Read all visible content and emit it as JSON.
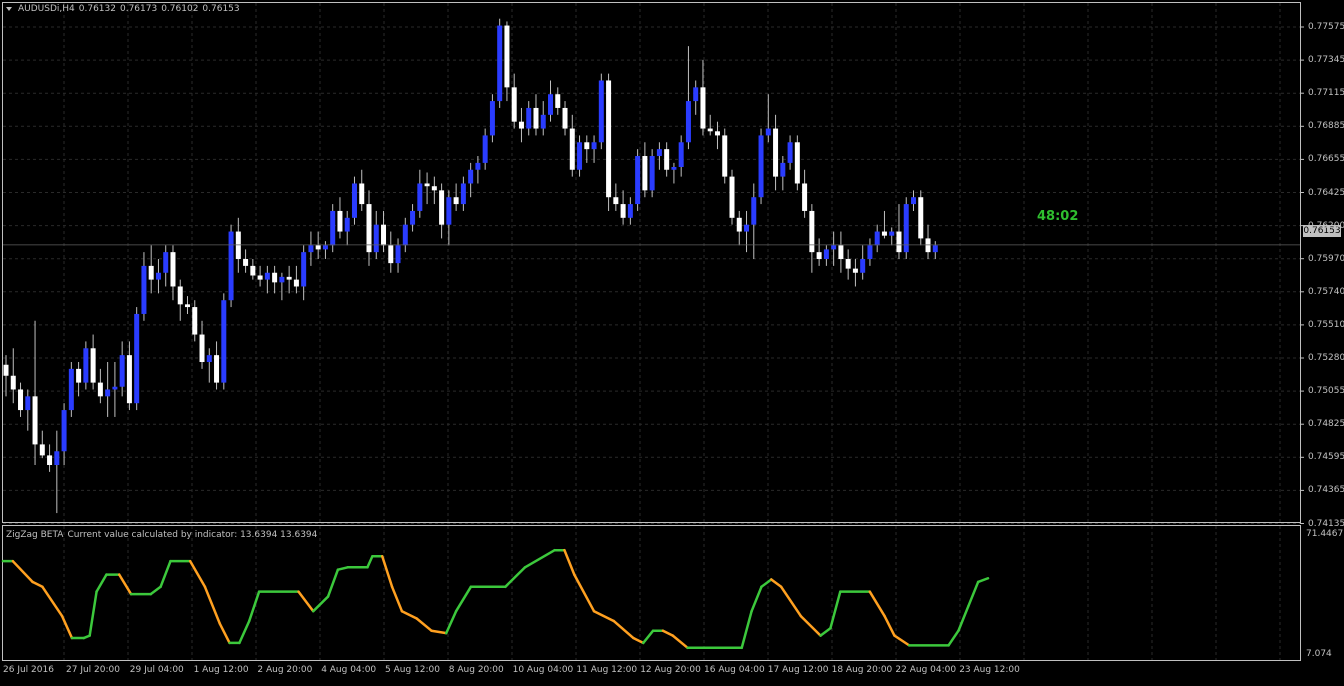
{
  "header": {
    "symbol": "AUDUSDi,H4",
    "ohlc": [
      "0.76132",
      "0.76173",
      "0.76102",
      "0.76153"
    ]
  },
  "timer": "48:02",
  "current_price": "0.76153",
  "price_axis": [
    "0.77575",
    "0.77345",
    "0.77115",
    "0.76885",
    "0.76655",
    "0.76425",
    "0.76200",
    "0.75970",
    "0.75740",
    "0.75510",
    "0.75280",
    "0.75055",
    "0.74825",
    "0.74595",
    "0.74365",
    "0.74135"
  ],
  "indicator": {
    "title": "ZigZag BETA",
    "subtitle": "Current value calculated by indicator: 13.6394 13.6394",
    "axis_max": "71.4467",
    "axis_min": "7.074"
  },
  "time_axis": [
    "26 Jul 2016",
    "27 Jul 20:00",
    "29 Jul 04:00",
    "1 Aug 12:00",
    "2 Aug 20:00",
    "4 Aug 04:00",
    "5 Aug 12:00",
    "8 Aug 20:00",
    "10 Aug 04:00",
    "11 Aug 12:00",
    "12 Aug 20:00",
    "16 Aug 04:00",
    "17 Aug 12:00",
    "18 Aug 20:00",
    "22 Aug 04:00",
    "23 Aug 12:00"
  ],
  "colors": {
    "bull": "#2a3cff",
    "bear": "#ffffff",
    "wick": "#c0c0c0",
    "grid": "#2a2a2a",
    "osc_up": "#3cc83c",
    "osc_down": "#ffa020",
    "timer": "#2fbf2f"
  },
  "chart_data": {
    "type": "candlestick",
    "ylim": [
      0.74135,
      0.77805
    ],
    "candles": [
      [
        0.7528,
        0.7535,
        0.7505,
        0.752
      ],
      [
        0.752,
        0.754,
        0.75,
        0.751
      ],
      [
        0.751,
        0.7515,
        0.749,
        0.7495
      ],
      [
        0.7495,
        0.751,
        0.748,
        0.7505
      ],
      [
        0.7505,
        0.756,
        0.7455,
        0.747
      ],
      [
        0.747,
        0.748,
        0.746,
        0.7462
      ],
      [
        0.7462,
        0.747,
        0.745,
        0.7455
      ],
      [
        0.7455,
        0.748,
        0.742,
        0.7465
      ],
      [
        0.7465,
        0.75,
        0.7455,
        0.7495
      ],
      [
        0.7495,
        0.753,
        0.749,
        0.7525
      ],
      [
        0.7525,
        0.753,
        0.7505,
        0.7515
      ],
      [
        0.7515,
        0.7545,
        0.751,
        0.754
      ],
      [
        0.754,
        0.755,
        0.751,
        0.7515
      ],
      [
        0.7515,
        0.7525,
        0.75,
        0.7505
      ],
      [
        0.7505,
        0.753,
        0.749,
        0.751
      ],
      [
        0.751,
        0.753,
        0.749,
        0.7512
      ],
      [
        0.7512,
        0.7545,
        0.7505,
        0.7535
      ],
      [
        0.7535,
        0.7545,
        0.7495,
        0.75
      ],
      [
        0.75,
        0.757,
        0.7495,
        0.7565
      ],
      [
        0.7565,
        0.761,
        0.756,
        0.76
      ],
      [
        0.76,
        0.7615,
        0.758,
        0.759
      ],
      [
        0.759,
        0.7605,
        0.758,
        0.7595
      ],
      [
        0.7595,
        0.7615,
        0.7585,
        0.761
      ],
      [
        0.761,
        0.7615,
        0.7575,
        0.7585
      ],
      [
        0.7585,
        0.759,
        0.756,
        0.7572
      ],
      [
        0.7572,
        0.7578,
        0.7565,
        0.757
      ],
      [
        0.757,
        0.7575,
        0.7545,
        0.755
      ],
      [
        0.755,
        0.756,
        0.7525,
        0.753
      ],
      [
        0.753,
        0.754,
        0.7515,
        0.7535
      ],
      [
        0.7535,
        0.7545,
        0.751,
        0.7515
      ],
      [
        0.7515,
        0.758,
        0.751,
        0.7575
      ],
      [
        0.7575,
        0.763,
        0.757,
        0.7625
      ],
      [
        0.7625,
        0.7635,
        0.7595,
        0.7605
      ],
      [
        0.7605,
        0.7612,
        0.7595,
        0.76
      ],
      [
        0.76,
        0.7605,
        0.759,
        0.7593
      ],
      [
        0.7593,
        0.76,
        0.7585,
        0.759
      ],
      [
        0.759,
        0.76,
        0.758,
        0.7595
      ],
      [
        0.7595,
        0.76,
        0.758,
        0.7588
      ],
      [
        0.7588,
        0.7595,
        0.7575,
        0.7592
      ],
      [
        0.7592,
        0.76,
        0.758,
        0.759
      ],
      [
        0.759,
        0.76,
        0.758,
        0.7585
      ],
      [
        0.7585,
        0.7615,
        0.7575,
        0.761
      ],
      [
        0.761,
        0.7625,
        0.76,
        0.7615
      ],
      [
        0.7615,
        0.7625,
        0.7605,
        0.7612
      ],
      [
        0.7612,
        0.7618,
        0.7605,
        0.7615
      ],
      [
        0.7615,
        0.7645,
        0.761,
        0.764
      ],
      [
        0.764,
        0.765,
        0.762,
        0.7625
      ],
      [
        0.7625,
        0.764,
        0.7615,
        0.7635
      ],
      [
        0.7635,
        0.7665,
        0.763,
        0.766
      ],
      [
        0.766,
        0.767,
        0.764,
        0.7645
      ],
      [
        0.7645,
        0.7655,
        0.76,
        0.761
      ],
      [
        0.761,
        0.764,
        0.7605,
        0.763
      ],
      [
        0.763,
        0.764,
        0.761,
        0.7615
      ],
      [
        0.7615,
        0.7625,
        0.7595,
        0.7602
      ],
      [
        0.7602,
        0.762,
        0.7595,
        0.7615
      ],
      [
        0.7615,
        0.7635,
        0.761,
        0.763
      ],
      [
        0.763,
        0.7645,
        0.7625,
        0.764
      ],
      [
        0.764,
        0.767,
        0.7635,
        0.766
      ],
      [
        0.766,
        0.7668,
        0.7645,
        0.7658
      ],
      [
        0.7658,
        0.7665,
        0.7645,
        0.7655
      ],
      [
        0.7655,
        0.766,
        0.762,
        0.763
      ],
      [
        0.763,
        0.7655,
        0.7615,
        0.765
      ],
      [
        0.765,
        0.766,
        0.764,
        0.7645
      ],
      [
        0.7645,
        0.7665,
        0.764,
        0.766
      ],
      [
        0.766,
        0.7675,
        0.765,
        0.767
      ],
      [
        0.767,
        0.768,
        0.766,
        0.7675
      ],
      [
        0.7675,
        0.77,
        0.767,
        0.7695
      ],
      [
        0.7695,
        0.7725,
        0.769,
        0.772
      ],
      [
        0.772,
        0.778,
        0.7715,
        0.7775
      ],
      [
        0.7775,
        0.7778,
        0.772,
        0.773
      ],
      [
        0.773,
        0.774,
        0.77,
        0.7705
      ],
      [
        0.7705,
        0.7715,
        0.769,
        0.77
      ],
      [
        0.77,
        0.772,
        0.7695,
        0.7715
      ],
      [
        0.7715,
        0.7725,
        0.7695,
        0.77
      ],
      [
        0.77,
        0.772,
        0.7695,
        0.771
      ],
      [
        0.771,
        0.7735,
        0.7705,
        0.7725
      ],
      [
        0.7725,
        0.773,
        0.771,
        0.7715
      ],
      [
        0.7715,
        0.772,
        0.7695,
        0.77
      ],
      [
        0.77,
        0.771,
        0.7665,
        0.767
      ],
      [
        0.767,
        0.7695,
        0.7665,
        0.769
      ],
      [
        0.769,
        0.7695,
        0.7675,
        0.7685
      ],
      [
        0.7685,
        0.7695,
        0.7675,
        0.769
      ],
      [
        0.769,
        0.774,
        0.7685,
        0.7735
      ],
      [
        0.7735,
        0.774,
        0.764,
        0.765
      ],
      [
        0.765,
        0.766,
        0.764,
        0.7645
      ],
      [
        0.7645,
        0.7655,
        0.763,
        0.7635
      ],
      [
        0.7635,
        0.765,
        0.763,
        0.7645
      ],
      [
        0.7645,
        0.7685,
        0.764,
        0.768
      ],
      [
        0.768,
        0.769,
        0.765,
        0.7655
      ],
      [
        0.7655,
        0.7685,
        0.765,
        0.768
      ],
      [
        0.768,
        0.769,
        0.767,
        0.7685
      ],
      [
        0.7685,
        0.769,
        0.7665,
        0.767
      ],
      [
        0.767,
        0.7675,
        0.766,
        0.7672
      ],
      [
        0.7672,
        0.7695,
        0.7665,
        0.769
      ],
      [
        0.769,
        0.776,
        0.7685,
        0.772
      ],
      [
        0.772,
        0.7735,
        0.771,
        0.773
      ],
      [
        0.773,
        0.775,
        0.7695,
        0.77
      ],
      [
        0.77,
        0.771,
        0.7695,
        0.7698
      ],
      [
        0.7698,
        0.7705,
        0.7685,
        0.7695
      ],
      [
        0.7695,
        0.77,
        0.766,
        0.7665
      ],
      [
        0.7665,
        0.767,
        0.763,
        0.7635
      ],
      [
        0.7635,
        0.764,
        0.7615,
        0.7625
      ],
      [
        0.7625,
        0.764,
        0.761,
        0.763
      ],
      [
        0.763,
        0.766,
        0.7605,
        0.765
      ],
      [
        0.765,
        0.77,
        0.7645,
        0.7695
      ],
      [
        0.7695,
        0.7725,
        0.769,
        0.77
      ],
      [
        0.77,
        0.771,
        0.7655,
        0.7665
      ],
      [
        0.7665,
        0.768,
        0.7655,
        0.7675
      ],
      [
        0.7675,
        0.7695,
        0.767,
        0.769
      ],
      [
        0.769,
        0.7695,
        0.7655,
        0.766
      ],
      [
        0.766,
        0.767,
        0.7635,
        0.764
      ],
      [
        0.764,
        0.7645,
        0.7595,
        0.761
      ],
      [
        0.761,
        0.762,
        0.76,
        0.7605
      ],
      [
        0.7605,
        0.7615,
        0.76,
        0.7612
      ],
      [
        0.7612,
        0.7625,
        0.76,
        0.7615
      ],
      [
        0.7615,
        0.7625,
        0.7595,
        0.7605
      ],
      [
        0.7605,
        0.7612,
        0.759,
        0.7598
      ],
      [
        0.7598,
        0.7605,
        0.7585,
        0.7595
      ],
      [
        0.7595,
        0.7615,
        0.759,
        0.7605
      ],
      [
        0.7605,
        0.762,
        0.76,
        0.7615
      ],
      [
        0.7615,
        0.763,
        0.761,
        0.7625
      ],
      [
        0.7625,
        0.764,
        0.762,
        0.7622
      ],
      [
        0.7622,
        0.7628,
        0.7615,
        0.7625
      ],
      [
        0.7625,
        0.7645,
        0.7605,
        0.761
      ],
      [
        0.761,
        0.765,
        0.7605,
        0.7645
      ],
      [
        0.7645,
        0.7655,
        0.764,
        0.765
      ],
      [
        0.765,
        0.7655,
        0.7615,
        0.762
      ],
      [
        0.762,
        0.763,
        0.7605,
        0.761
      ],
      [
        0.761,
        0.7618,
        0.7605,
        0.7615
      ]
    ],
    "oscillator": [
      {
        "x": 0.0,
        "y": 60.5
      },
      {
        "x": 0.01,
        "y": 60.5
      },
      {
        "x": 0.03,
        "y": 52.0
      },
      {
        "x": 0.04,
        "y": 50.0
      },
      {
        "x": 0.06,
        "y": 38.0
      },
      {
        "x": 0.07,
        "y": 29.0
      },
      {
        "x": 0.082,
        "y": 29.0
      },
      {
        "x": 0.088,
        "y": 30.0
      },
      {
        "x": 0.095,
        "y": 48.0
      },
      {
        "x": 0.105,
        "y": 55.0
      },
      {
        "x": 0.118,
        "y": 55.0
      },
      {
        "x": 0.13,
        "y": 47.0
      },
      {
        "x": 0.15,
        "y": 47.0
      },
      {
        "x": 0.16,
        "y": 50.0
      },
      {
        "x": 0.17,
        "y": 60.5
      },
      {
        "x": 0.19,
        "y": 60.5
      },
      {
        "x": 0.205,
        "y": 50.0
      },
      {
        "x": 0.22,
        "y": 35.0
      },
      {
        "x": 0.23,
        "y": 27.0
      },
      {
        "x": 0.24,
        "y": 27.0
      },
      {
        "x": 0.25,
        "y": 36.0
      },
      {
        "x": 0.26,
        "y": 48.0
      },
      {
        "x": 0.3,
        "y": 48.0
      },
      {
        "x": 0.315,
        "y": 40.0
      },
      {
        "x": 0.33,
        "y": 46.0
      },
      {
        "x": 0.34,
        "y": 57.0
      },
      {
        "x": 0.35,
        "y": 58.0
      },
      {
        "x": 0.37,
        "y": 58.0
      },
      {
        "x": 0.375,
        "y": 62.5
      },
      {
        "x": 0.385,
        "y": 62.5
      },
      {
        "x": 0.395,
        "y": 50.0
      },
      {
        "x": 0.405,
        "y": 40.0
      },
      {
        "x": 0.42,
        "y": 37.0
      },
      {
        "x": 0.435,
        "y": 32.0
      },
      {
        "x": 0.45,
        "y": 31.0
      },
      {
        "x": 0.46,
        "y": 40.0
      },
      {
        "x": 0.475,
        "y": 50.0
      },
      {
        "x": 0.51,
        "y": 50.0
      },
      {
        "x": 0.53,
        "y": 58.0
      },
      {
        "x": 0.56,
        "y": 65.0
      },
      {
        "x": 0.57,
        "y": 65.0
      },
      {
        "x": 0.58,
        "y": 55.0
      },
      {
        "x": 0.6,
        "y": 40.0
      },
      {
        "x": 0.62,
        "y": 36.0
      },
      {
        "x": 0.64,
        "y": 29.0
      },
      {
        "x": 0.65,
        "y": 27.0
      },
      {
        "x": 0.66,
        "y": 32.0
      },
      {
        "x": 0.67,
        "y": 32.0
      },
      {
        "x": 0.68,
        "y": 30.0
      },
      {
        "x": 0.695,
        "y": 25.0
      },
      {
        "x": 0.75,
        "y": 25.0
      },
      {
        "x": 0.76,
        "y": 40.0
      },
      {
        "x": 0.77,
        "y": 50.0
      },
      {
        "x": 0.78,
        "y": 53.0
      },
      {
        "x": 0.79,
        "y": 50.0
      },
      {
        "x": 0.81,
        "y": 38.0
      },
      {
        "x": 0.83,
        "y": 30.0
      },
      {
        "x": 0.84,
        "y": 33.0
      },
      {
        "x": 0.85,
        "y": 48.0
      },
      {
        "x": 0.88,
        "y": 48.0
      },
      {
        "x": 0.895,
        "y": 38.0
      },
      {
        "x": 0.905,
        "y": 30.0
      },
      {
        "x": 0.92,
        "y": 26.0
      },
      {
        "x": 0.96,
        "y": 26.0
      },
      {
        "x": 0.97,
        "y": 32.0
      },
      {
        "x": 0.98,
        "y": 42.0
      },
      {
        "x": 0.99,
        "y": 52.0
      },
      {
        "x": 1.0,
        "y": 53.5
      }
    ]
  }
}
